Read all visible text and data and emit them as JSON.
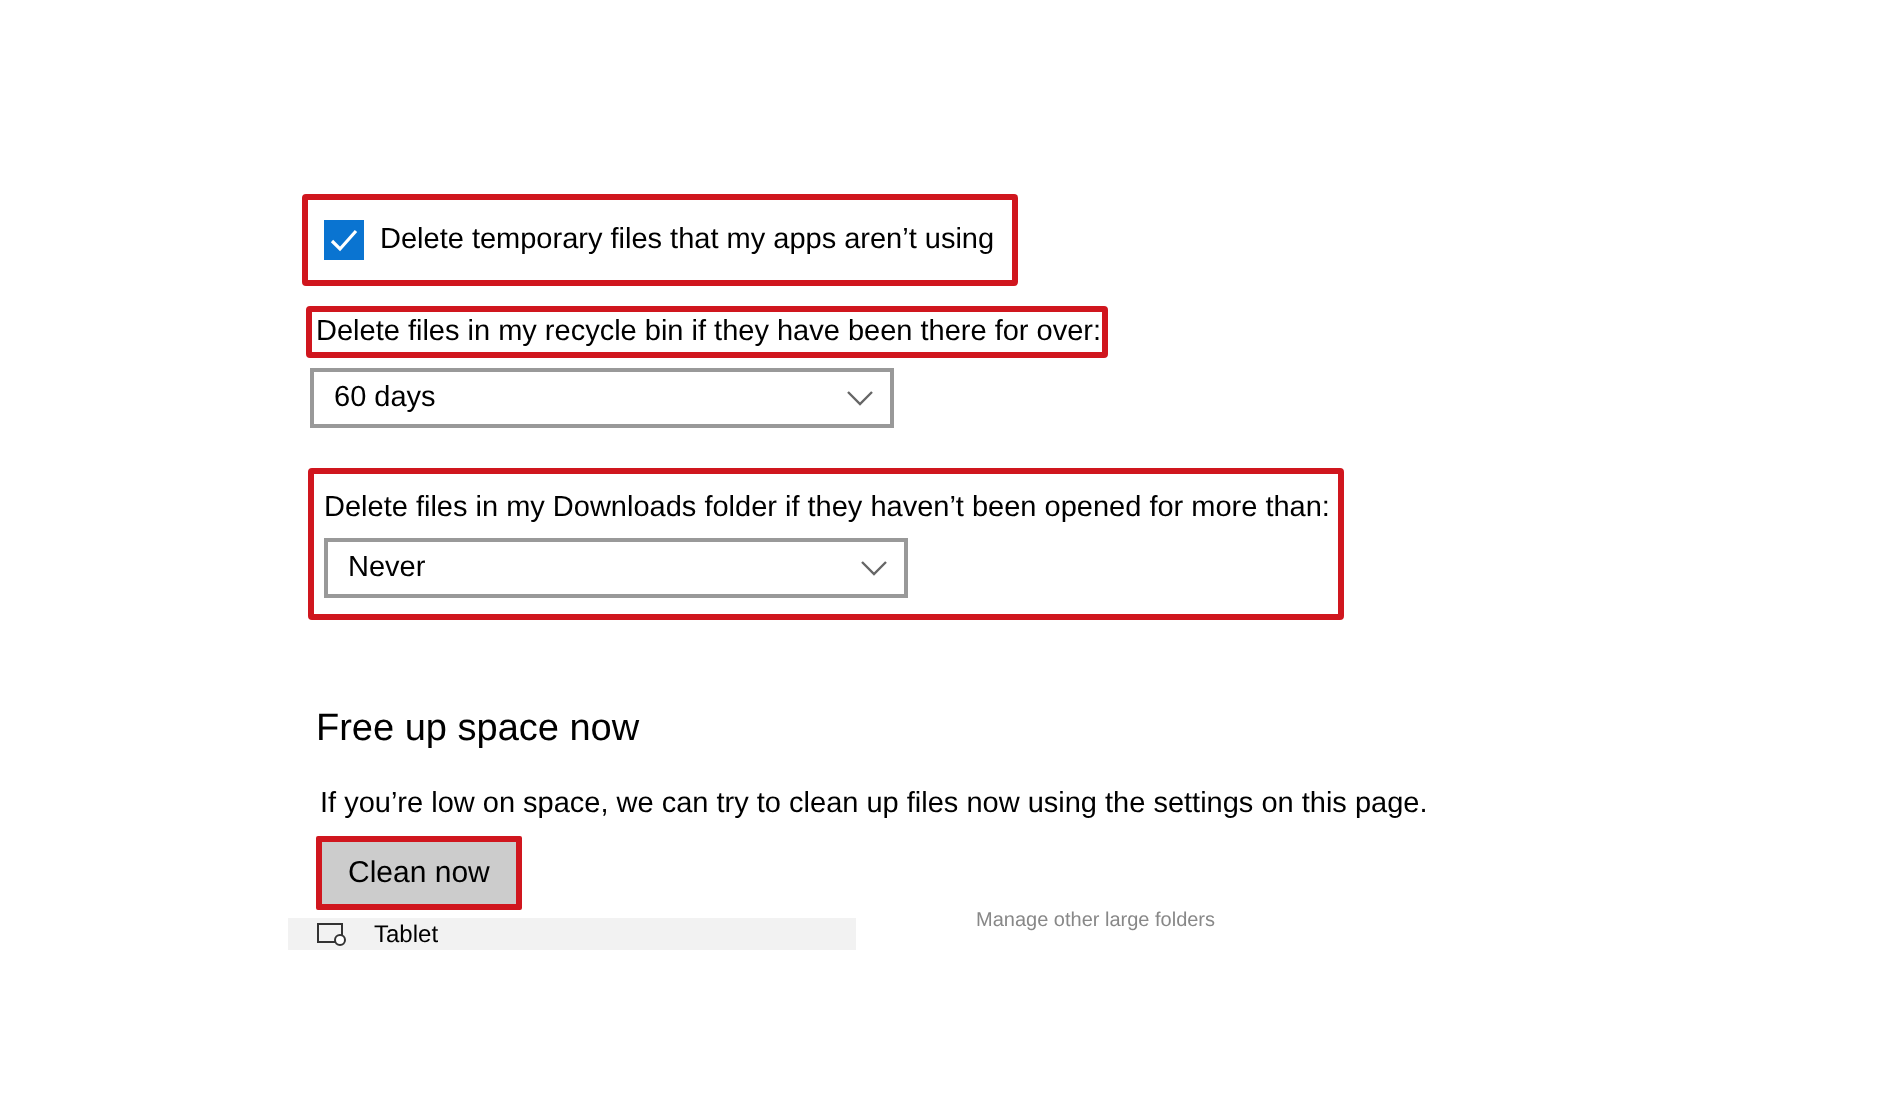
{
  "options": [
    {
      "kind": "checkbox",
      "label": "Delete temporary files that my apps aren’t using",
      "checked": true,
      "highlighted": true
    },
    {
      "kind": "dropdown",
      "label": "Delete files in my recycle bin if they have been there for over:",
      "value": "60 days",
      "label_highlighted": true
    },
    {
      "kind": "dropdown",
      "label": "Delete files in my Downloads folder if they haven’t been opened for more than:",
      "value": "Never",
      "highlighted": true
    }
  ],
  "free_up": {
    "heading": "Free up space now",
    "text": "If you’re low on space, we can try to clean up files now using the settings on this page.",
    "button": {
      "label": "Clean now",
      "highlighted": true
    }
  },
  "bottom": {
    "sidebar_item": "Tablet",
    "link": "Manage other large folders"
  }
}
